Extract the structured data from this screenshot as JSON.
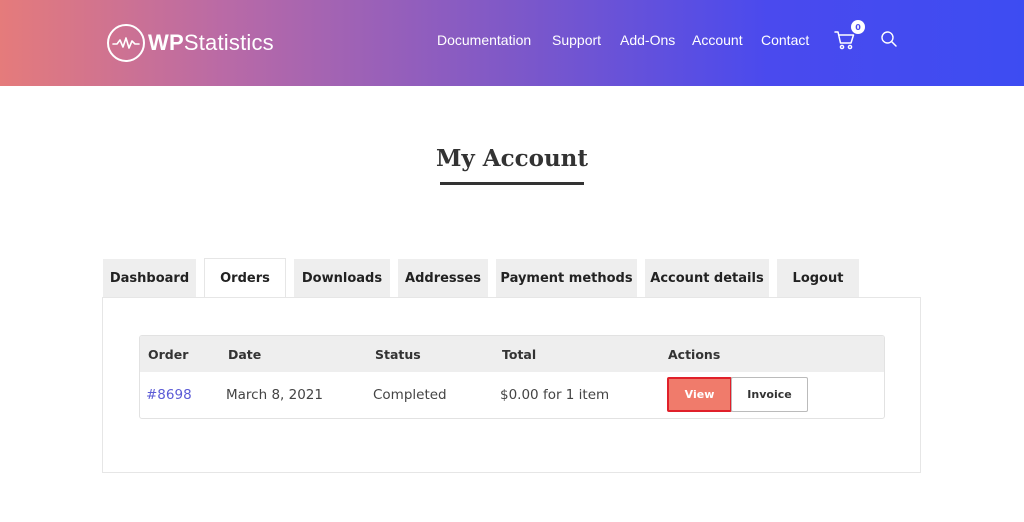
{
  "header": {
    "logo": {
      "text_prefix": "WP",
      "text_suffix": "Statistics",
      "icon": "wave-logo-icon"
    },
    "nav": [
      {
        "label": "Documentation"
      },
      {
        "label": "Support"
      },
      {
        "label": "Add-Ons"
      },
      {
        "label": "Account"
      },
      {
        "label": "Contact"
      }
    ],
    "cart_count": "0",
    "icons": {
      "cart": "cart-icon",
      "search": "search-icon"
    },
    "gradient": [
      "#e57b7b",
      "#7e58c8",
      "#3d4cf2"
    ]
  },
  "page": {
    "title": "My Account"
  },
  "tabs": [
    {
      "label": "Dashboard"
    },
    {
      "label": "Orders",
      "active": true
    },
    {
      "label": "Downloads"
    },
    {
      "label": "Addresses"
    },
    {
      "label": "Payment methods"
    },
    {
      "label": "Account details"
    },
    {
      "label": "Logout"
    }
  ],
  "orders": {
    "columns": [
      "Order",
      "Date",
      "Status",
      "Total",
      "Actions"
    ],
    "rows": [
      {
        "order": "#8698",
        "date": "March 8, 2021",
        "status": "Completed",
        "total": "$0.00 for 1 item",
        "actions": {
          "view": "View",
          "invoice": "Invoice"
        }
      }
    ]
  },
  "colors": {
    "view_button": "#f07b6b",
    "view_border": "#e0202a",
    "link": "#5b5bd6"
  }
}
